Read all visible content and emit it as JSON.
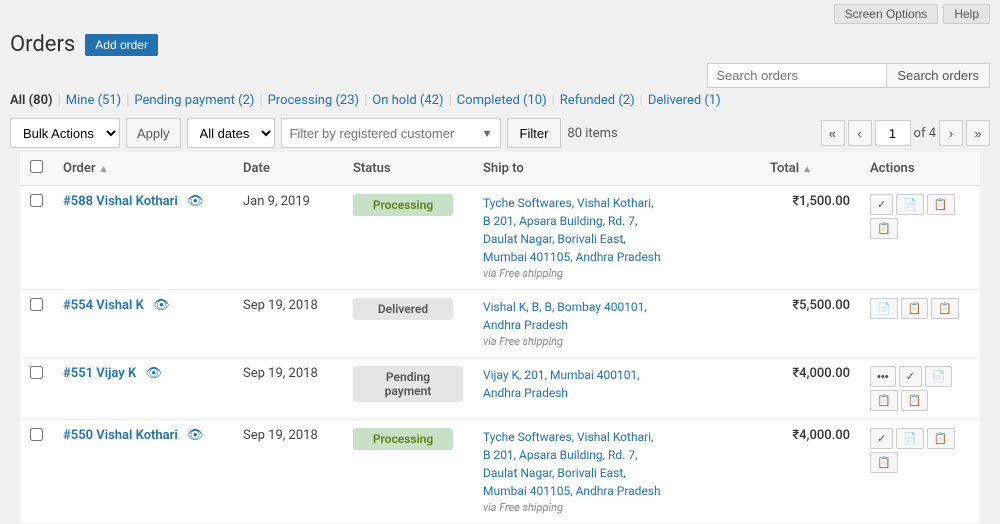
{
  "topbar": {
    "screen_options": "Screen Options",
    "help": "Help"
  },
  "header": {
    "title": "Orders",
    "add_order": "Add order"
  },
  "search": {
    "placeholder": "Search orders",
    "button": "Search orders"
  },
  "nav": {
    "tabs": [
      {
        "label": "All",
        "count": "80",
        "current": true
      },
      {
        "label": "Mine",
        "count": "51",
        "current": false
      },
      {
        "label": "Pending payment",
        "count": "2",
        "current": false
      },
      {
        "label": "Processing",
        "count": "23",
        "current": false
      },
      {
        "label": "On hold",
        "count": "42",
        "current": false
      },
      {
        "label": "Completed",
        "count": "10",
        "current": false
      },
      {
        "label": "Refunded",
        "count": "2",
        "current": false
      },
      {
        "label": "Delivered",
        "count": "1",
        "current": false
      }
    ]
  },
  "toolbar": {
    "bulk_actions": "Bulk Actions",
    "apply": "Apply",
    "all_dates": "All dates",
    "filter_placeholder": "Filter by registered customer",
    "filter_btn": "Filter",
    "items_count": "80 items",
    "page_current": "1",
    "page_total": "4"
  },
  "table": {
    "columns": [
      "",
      "Order",
      "Date",
      "Status",
      "Ship to",
      "Total",
      "Actions"
    ],
    "rows": [
      {
        "id": "#588",
        "name": "Vishal Kothari",
        "date": "Jan 9, 2019",
        "status": "Processing",
        "status_type": "processing",
        "ship_line1": "Tyche Softwares, Vishal Kothari,",
        "ship_line2": "B 201, Apsara Building, Rd. 7,",
        "ship_line3": "Daulat Nagar, Borivali East,",
        "ship_line4": "Mumbai 401105, Andhra Pradesh",
        "ship_via": "via Free shipping",
        "total": "₹1,500.00",
        "actions": [
          "✓",
          "📄",
          "📋",
          "📋"
        ]
      },
      {
        "id": "#554",
        "name": "Vishal K",
        "date": "Sep 19, 2018",
        "status": "Delivered",
        "status_type": "delivered",
        "ship_line1": "Vishal K, B, B, Bombay 400101,",
        "ship_line2": "Andhra Pradesh",
        "ship_line3": "",
        "ship_line4": "",
        "ship_via": "via Free shipping",
        "total": "₹5,500.00",
        "actions": [
          "📄",
          "📋",
          "📋"
        ]
      },
      {
        "id": "#551",
        "name": "Vijay K",
        "date": "Sep 19, 2018",
        "status": "Pending payment",
        "status_type": "pending",
        "ship_line1": "Vijay K, 201, Mumbai 400101,",
        "ship_line2": "Andhra Pradesh",
        "ship_line3": "",
        "ship_line4": "",
        "ship_via": "",
        "total": "₹4,000.00",
        "actions": [
          "•••",
          "✓",
          "📄",
          "📋",
          "📋"
        ]
      },
      {
        "id": "#550",
        "name": "Vishal Kothari",
        "date": "Sep 19, 2018",
        "status": "Processing",
        "status_type": "processing",
        "ship_line1": "Tyche Softwares, Vishal Kothari,",
        "ship_line2": "B 201, Apsara Building, Rd. 7,",
        "ship_line3": "Daulat Nagar, Borivali East,",
        "ship_line4": "Mumbai 401105, Andhra Pradesh",
        "ship_via": "via Free shipping",
        "total": "₹4,000.00",
        "actions": [
          "✓",
          "📄",
          "📋",
          "📋"
        ]
      }
    ]
  }
}
